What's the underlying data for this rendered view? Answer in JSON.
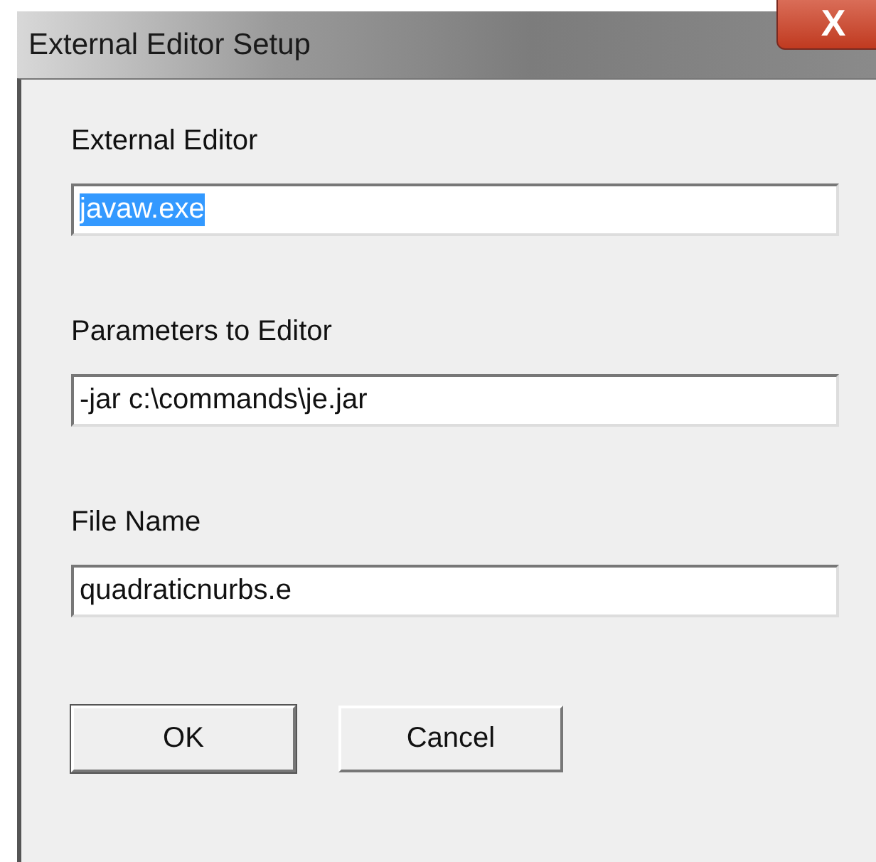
{
  "window": {
    "title": "External Editor Setup",
    "close": "X"
  },
  "fields": [
    {
      "label": "External Editor",
      "value": "javaw.exe",
      "text_selected": true
    },
    {
      "label": "Parameters to Editor",
      "value": "-jar c:\\commands\\je.jar",
      "text_selected": false
    },
    {
      "label": "File Name",
      "value": "quadraticnurbs.e",
      "text_selected": false
    }
  ],
  "buttons": [
    {
      "label": "OK",
      "default": true
    },
    {
      "label": "Cancel",
      "default": false
    }
  ]
}
